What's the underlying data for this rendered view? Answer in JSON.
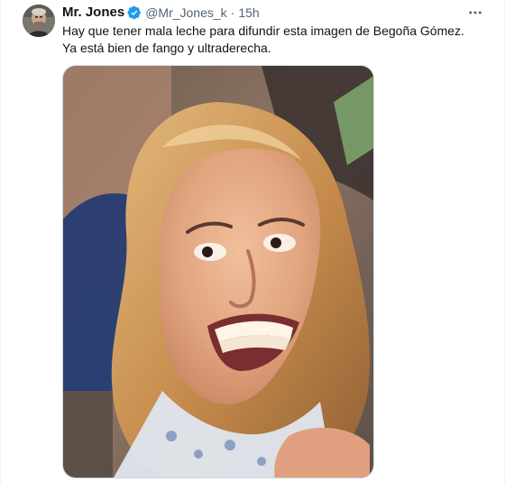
{
  "tweet": {
    "author_name": "Mr. Jones",
    "handle": "@Mr_Jones_k",
    "separator": "·",
    "timestamp": "15h",
    "text_lines": [
      "Hay que tener mala leche para difundir esta imagen de Begoña Gómez.",
      "Ya está bien de fango y ultraderecha."
    ]
  },
  "icons": {
    "verified": "verified-badge-icon",
    "more": "more-options-icon"
  },
  "colors": {
    "verified_blue": "#1d9bf0",
    "text": "#0f1419",
    "secondary_text": "#536471",
    "media_border": "#cfd9de"
  }
}
